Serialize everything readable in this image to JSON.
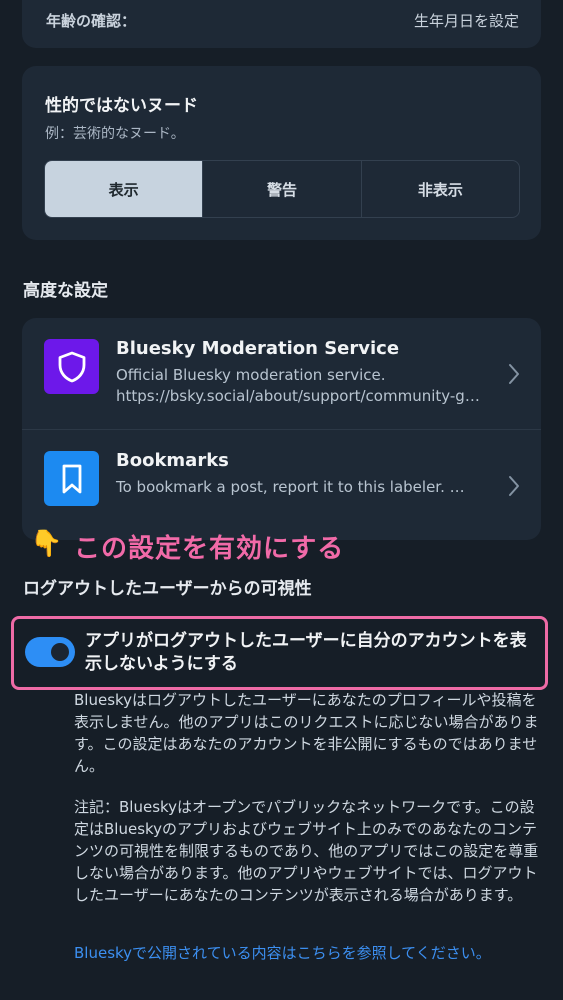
{
  "top_setting": {
    "label": "年齢の確認：",
    "value": "生年月日を設定"
  },
  "non_sexual_nudity": {
    "title": "性的ではないヌード",
    "subtitle": "例：芸術的なヌード。",
    "options": [
      "表示",
      "警告",
      "非表示"
    ],
    "selected": "表示"
  },
  "advanced": {
    "title": "高度な設定",
    "labelers": [
      {
        "name": "Bluesky Moderation Service",
        "description": "Official Bluesky moderation service. https://bsky.social/about/support/community-g…",
        "icon": "shield-icon",
        "icon_color": "#6d18ea"
      },
      {
        "name": "Bookmarks",
        "description": "To bookmark a post, report it to this labeler. …",
        "icon": "bookmark-icon",
        "icon_color": "#1c8af1"
      }
    ]
  },
  "annotation": {
    "emoji": "👇",
    "text": "この設定を有効にする"
  },
  "logged_out_visibility": {
    "title": "ログアウトしたユーザーからの可視性",
    "toggle_label": "アプリがログアウトしたユーザーに自分のアカウントを表示しないようにする",
    "toggle_on": true,
    "description": "Blueskyはログアウトしたユーザーにあなたのプロフィールや投稿を表示しません。他のアプリはこのリクエストに応じない場合があります。この設定はあなたのアカウントを非公開にするものではありません。",
    "note": "注記：Blueskyはオープンでパブリックなネットワークです。この設定はBlueskyのアプリおよびウェブサイト上のみでのあなたのコンテンツの可視性を制限するものであり、他のアプリではこの設定を尊重しない場合があります。他のアプリやウェブサイトでは、ログアウトしたユーザーにあなたのコンテンツが表示される場合があります。",
    "link": "Blueskyで公開されている内容はこちらを参照してください。"
  },
  "colors": {
    "accent": "#2d8ef5",
    "highlight": "#ee6ba6",
    "background": "#161e27"
  }
}
